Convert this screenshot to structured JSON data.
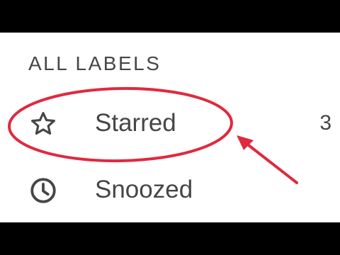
{
  "section": {
    "header": "ALL LABELS"
  },
  "nav": {
    "items": [
      {
        "label": "Starred",
        "count": "3",
        "icon": "star-icon"
      },
      {
        "label": "Snoozed",
        "icon": "clock-icon"
      }
    ]
  },
  "annotation": {
    "color": "#e0293e",
    "shapes": [
      "highlight-ellipse",
      "pointer-arrow"
    ]
  },
  "colors": {
    "text": "#444746",
    "background": "#ffffff",
    "letterbox": "#000000"
  }
}
